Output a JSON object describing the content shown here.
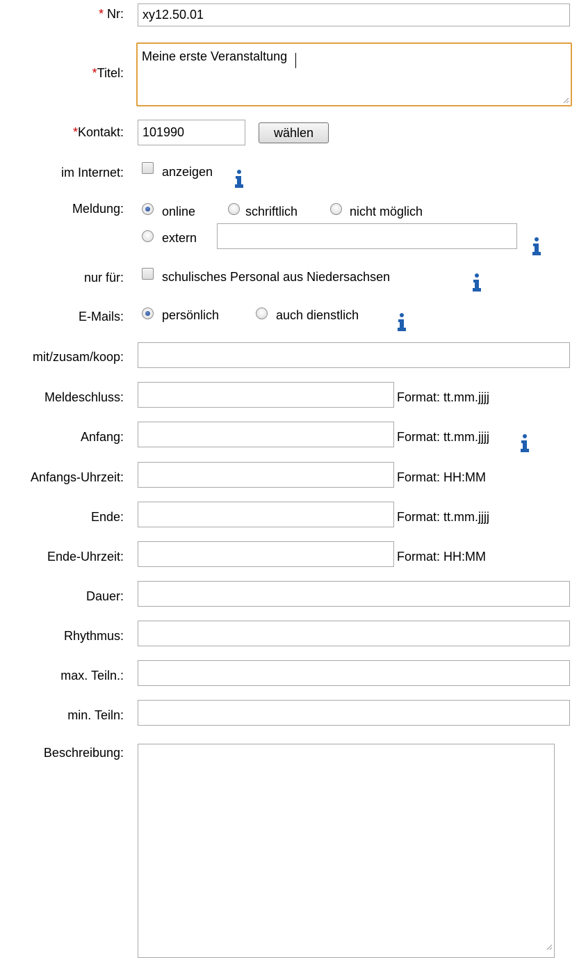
{
  "form": {
    "nr": {
      "star": "*",
      "label": " Nr:",
      "value": "xy12.50.01"
    },
    "titel": {
      "star": "*",
      "label": "Titel:",
      "value": "Meine erste Veranstaltung"
    },
    "kontakt": {
      "star": "*",
      "label": "Kontakt:",
      "value": "101990",
      "button": "wählen"
    },
    "internet": {
      "label": "im Internet:",
      "checkbox_label": "anzeigen",
      "checked": false
    },
    "meldung": {
      "label": "Meldung:",
      "options": [
        "online",
        "schriftlich",
        "nicht möglich",
        "extern"
      ],
      "selected": "online",
      "extern_value": ""
    },
    "nur_fuer": {
      "label": "nur für:",
      "checkbox_label": "schulisches Personal aus Niedersachsen",
      "checked": false
    },
    "emails": {
      "label": "E-Mails:",
      "options": [
        "persönlich",
        "auch dienstlich"
      ],
      "selected": "persönlich"
    },
    "mit_zusam_koop": {
      "label": "mit/zusam/koop:",
      "value": ""
    },
    "meldeschluss": {
      "label": "Meldeschluss:",
      "value": "",
      "hint": "Format: tt.mm.jjjj"
    },
    "anfang": {
      "label": "Anfang:",
      "value": "",
      "hint": "Format: tt.mm.jjjj"
    },
    "anfangs_uhrzeit": {
      "label": "Anfangs-Uhrzeit:",
      "value": "",
      "hint": "Format: HH:MM"
    },
    "ende": {
      "label": "Ende:",
      "value": "",
      "hint": "Format: tt.mm.jjjj"
    },
    "ende_uhrzeit": {
      "label": "Ende-Uhrzeit:",
      "value": "",
      "hint": "Format: HH:MM"
    },
    "dauer": {
      "label": "Dauer:",
      "value": ""
    },
    "rhythmus": {
      "label": "Rhythmus:",
      "value": ""
    },
    "max_teiln": {
      "label": "max. Teiln.:",
      "value": ""
    },
    "min_teiln": {
      "label": "min. Teiln:",
      "value": ""
    },
    "beschreibung": {
      "label": "Beschreibung:",
      "value": ""
    }
  },
  "colors": {
    "required_star": "#cc0000",
    "focus_border": "#e0a040",
    "info_icon": "#1f5fb0"
  },
  "icons": {
    "info": "info-icon"
  }
}
